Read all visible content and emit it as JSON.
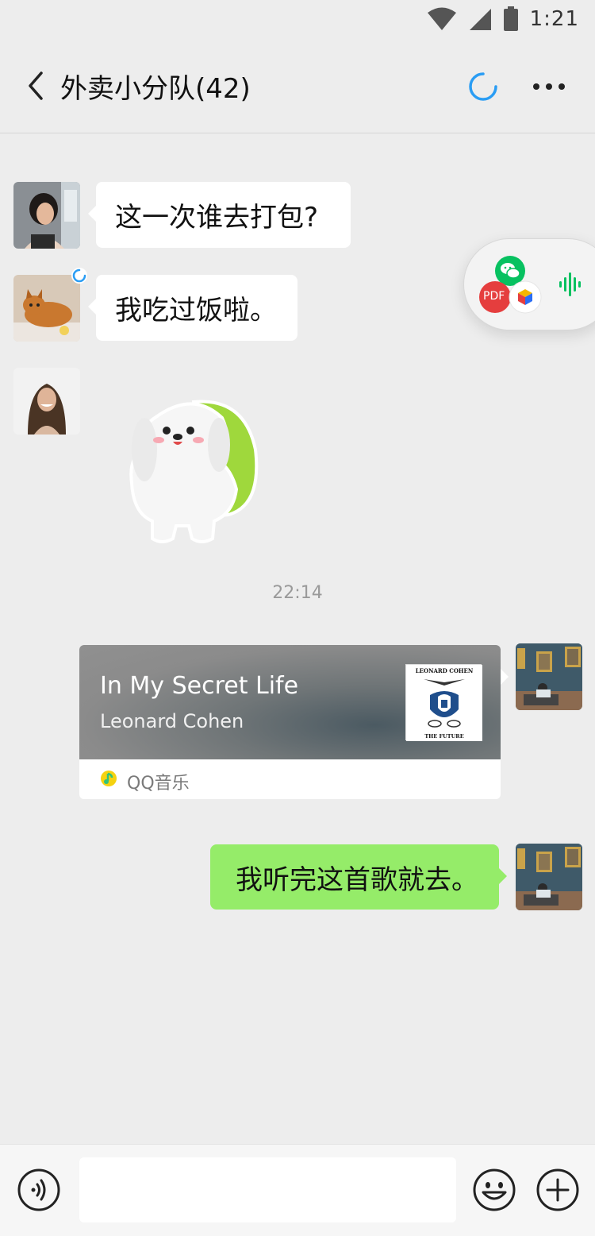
{
  "status_bar": {
    "time": "1:21",
    "icons": [
      "wifi-icon",
      "signal-icon",
      "battery-icon"
    ]
  },
  "header": {
    "title": "外卖小分队(42)",
    "icons": [
      "back-arrow-icon",
      "refresh-icon",
      "more-icon"
    ]
  },
  "messages": [
    {
      "side": "left",
      "avatar": "woman-avatar",
      "text": "这一次谁去打包?"
    },
    {
      "side": "left",
      "avatar": "cat-avatar",
      "text": "我吃过饭啦。"
    },
    {
      "side": "left",
      "avatar": "smiling-woman-avatar",
      "type": "sticker",
      "sticker": "white-green-dog-sticker"
    }
  ],
  "timestamp": "22:14",
  "music_card": {
    "title": "In My Secret Life",
    "artist": "Leonard Cohen",
    "source": "QQ音乐",
    "album_text_top": "LEONARD COHEN",
    "album_text_bottom": "THE FUTURE"
  },
  "my_message": {
    "text": "我听完这首歌就去。"
  },
  "floating_widget": {
    "badge_pdf": "PDF",
    "icons": [
      "wechat-icon",
      "pdf-icon",
      "box-icon",
      "audio-wave-icon"
    ]
  },
  "bottom_bar": {
    "input_value": "",
    "icons": [
      "voice-icon",
      "emoji-icon",
      "plus-icon"
    ]
  },
  "colors": {
    "background": "#ededed",
    "bubble_green": "#95ec69",
    "accent_blue": "#2a9df4",
    "wechat_green": "#07c160"
  }
}
